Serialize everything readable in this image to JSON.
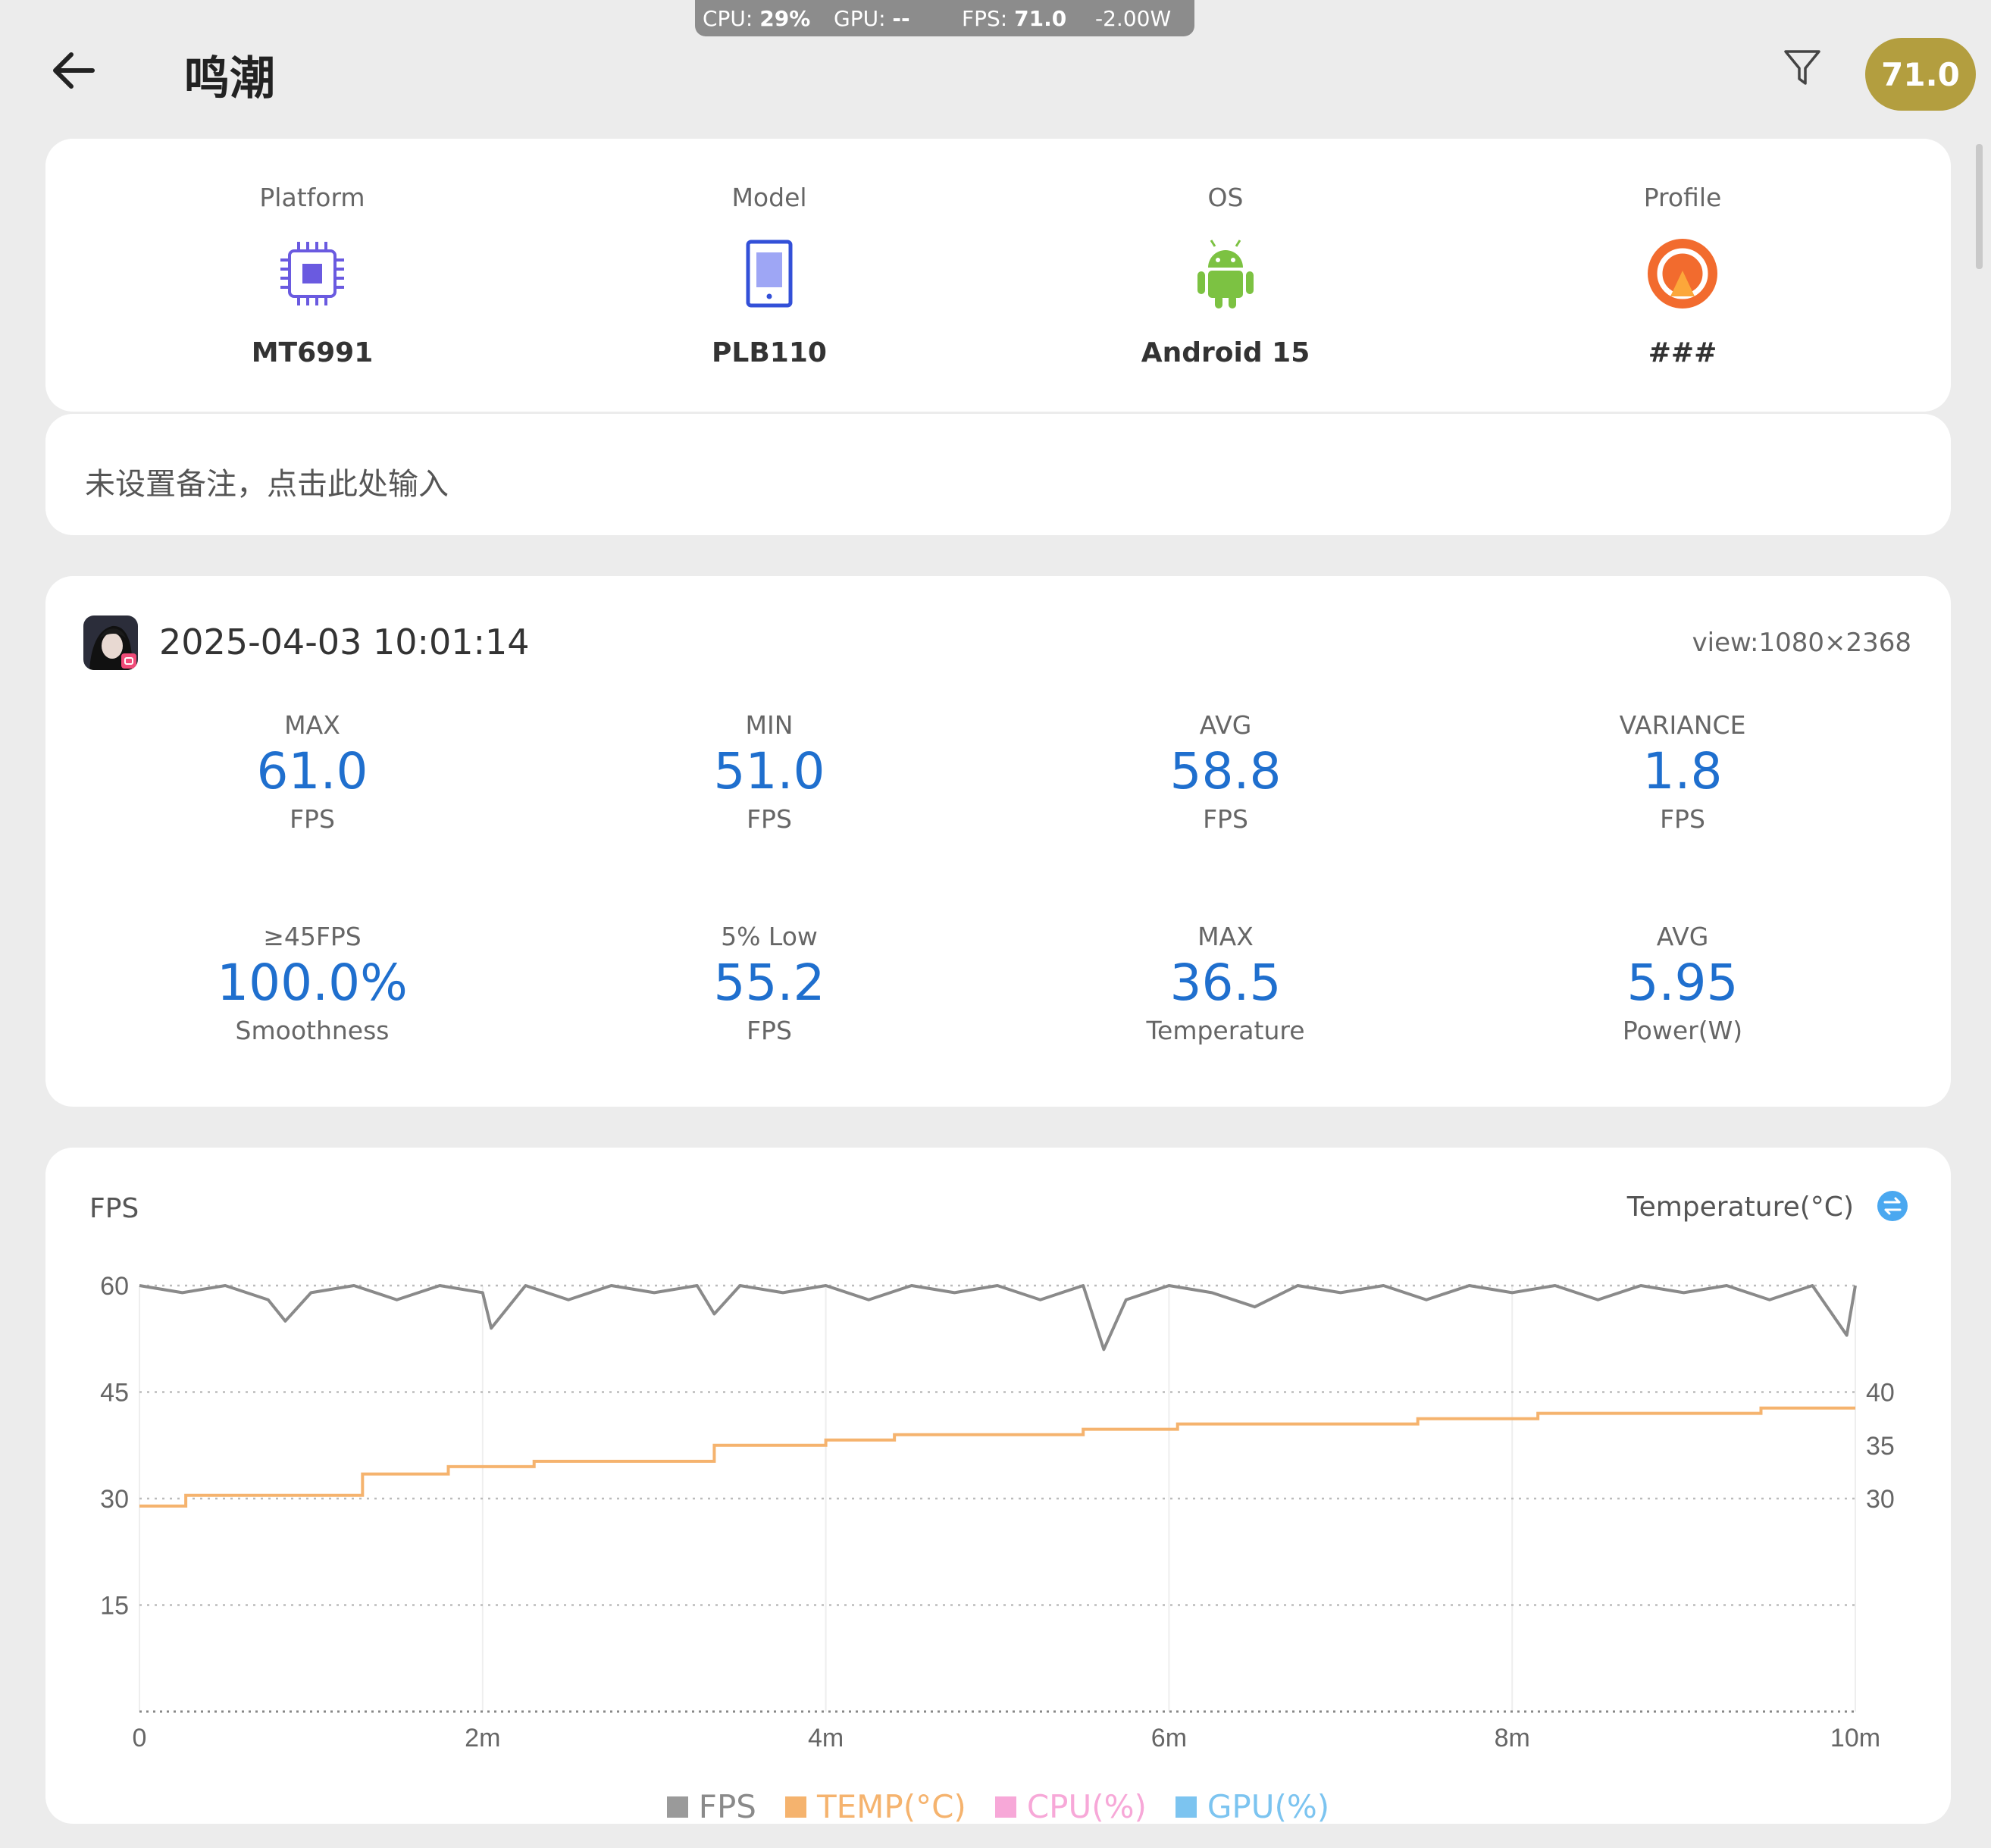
{
  "overlay": {
    "cpu_label": "CPU:",
    "cpu_value": "29%",
    "gpu_label": "GPU:",
    "gpu_value": "--",
    "fps_label": "FPS:",
    "fps_value": "71.0",
    "power": "-2.00W"
  },
  "header": {
    "title": "鸣潮",
    "fps_badge": "71.0"
  },
  "device": [
    {
      "label": "Platform",
      "value": "MT6991",
      "icon": "chip-icon"
    },
    {
      "label": "Model",
      "value": "PLB110",
      "icon": "phone-icon"
    },
    {
      "label": "OS",
      "value": "Android 15",
      "icon": "android-icon"
    },
    {
      "label": "Profile",
      "value": "###",
      "icon": "profile-icon"
    }
  ],
  "note": {
    "placeholder": "未设置备注，点击此处输入"
  },
  "session": {
    "timestamp": "2025-04-03 10:01:14",
    "view": "view:1080×2368",
    "stats": [
      {
        "label": "MAX",
        "value": "61.0",
        "unit": "FPS"
      },
      {
        "label": "MIN",
        "value": "51.0",
        "unit": "FPS"
      },
      {
        "label": "AVG",
        "value": "58.8",
        "unit": "FPS"
      },
      {
        "label": "VARIANCE",
        "value": "1.8",
        "unit": "FPS"
      },
      {
        "label": "≥45FPS",
        "value": "100.0%",
        "unit": "Smoothness"
      },
      {
        "label": "5% Low",
        "value": "55.2",
        "unit": "FPS"
      },
      {
        "label": "MAX",
        "value": "36.5",
        "unit": "Temperature"
      },
      {
        "label": "AVG",
        "value": "5.95",
        "unit": "Power(W)"
      }
    ]
  },
  "colors": {
    "accent": "#1f6fce",
    "fps_line": "#8a8a8a",
    "temp_line": "#f5b36e",
    "cpu": "#f7a8d8",
    "gpu": "#7cc4f0",
    "badge": "#b39e3f"
  },
  "chart_data": {
    "type": "line",
    "left_axis_label": "FPS",
    "right_axis_label": "Temperature(°C)",
    "x_ticks": [
      "0",
      "2m",
      "4m",
      "6m",
      "8m",
      "10m"
    ],
    "y_left_ticks": [
      "60",
      "45",
      "30",
      "15"
    ],
    "y_right_ticks": [
      "40",
      "35",
      "30"
    ],
    "ylim_left": [
      0,
      60
    ],
    "ylim_right": [
      20,
      40
    ],
    "xlim_minutes": [
      0,
      10
    ],
    "legend": [
      "FPS",
      "TEMP(°C)",
      "CPU(%)",
      "GPU(%)"
    ],
    "series": [
      {
        "name": "FPS",
        "x_minutes": [
          0,
          0.25,
          0.5,
          0.75,
          0.85,
          1,
          1.25,
          1.5,
          1.75,
          2,
          2.05,
          2.25,
          2.5,
          2.75,
          3,
          3.25,
          3.35,
          3.5,
          3.75,
          4,
          4.25,
          4.5,
          4.75,
          5,
          5.25,
          5.5,
          5.62,
          5.75,
          6,
          6.25,
          6.5,
          6.75,
          7,
          7.25,
          7.5,
          7.75,
          8,
          8.25,
          8.5,
          8.75,
          9,
          9.25,
          9.5,
          9.75,
          9.95,
          10
        ],
        "values": [
          60,
          59,
          60,
          58,
          55,
          59,
          60,
          58,
          60,
          59,
          54,
          60,
          58,
          60,
          59,
          60,
          56,
          60,
          59,
          60,
          58,
          60,
          59,
          60,
          58,
          60,
          51,
          58,
          60,
          59,
          57,
          60,
          59,
          60,
          58,
          60,
          59,
          60,
          58,
          60,
          59,
          60,
          58,
          60,
          53,
          60
        ]
      },
      {
        "name": "TEMP(°C)",
        "x_minutes": [
          0,
          0.27,
          0.27,
          1.3,
          1.3,
          1.8,
          1.8,
          2.3,
          2.3,
          3.35,
          3.35,
          4.0,
          4.0,
          4.4,
          4.4,
          5.5,
          5.5,
          6.05,
          6.05,
          7.45,
          7.45,
          8.15,
          8.15,
          9.45,
          9.45,
          10
        ],
        "values": [
          29.3,
          29.3,
          30.3,
          30.3,
          32.3,
          32.3,
          33.0,
          33.0,
          33.5,
          33.5,
          35.0,
          35.0,
          35.5,
          35.5,
          36.0,
          36.0,
          36.5,
          36.5,
          37.0,
          37.0,
          37.5,
          37.5,
          38.0,
          38.0,
          38.5,
          38.5
        ]
      }
    ]
  }
}
